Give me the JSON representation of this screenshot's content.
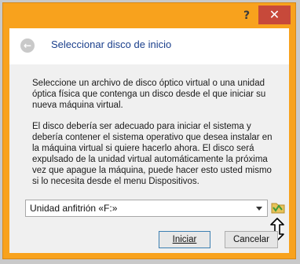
{
  "titlebar": {
    "help_label": "?",
    "close_label": "✕"
  },
  "header": {
    "back_icon": "back-arrow-icon",
    "title": "Seleccionar disco de inicio"
  },
  "body": {
    "paragraph1": "Seleccione un archivo de disco óptico virtual o una unidad óptica física que contenga un disco desde el que iniciar su nueva máquina virtual.",
    "paragraph2": "El disco debería ser adecuado para iniciar el sistema y debería contener el sistema operativo que desea instalar en la máquina virtual si quiere hacerlo ahora. El disco será expulsado de la unidad virtual automáticamente la próxima vez que apague la máquina, puede hacer esto usted mismo si lo necesita desde el menu Dispositivos."
  },
  "drive_select": {
    "value": "Unidad anfitrión «F:»"
  },
  "icons": {
    "folder": "folder-browse-icon",
    "resize": "vertical-resize-icon"
  },
  "buttons": {
    "start_label": "Iniciar",
    "cancel_label": "Cancelar"
  },
  "colors": {
    "titlebar": "#f8a21d",
    "close": "#c7493a",
    "title_text": "#1a3f8c"
  }
}
